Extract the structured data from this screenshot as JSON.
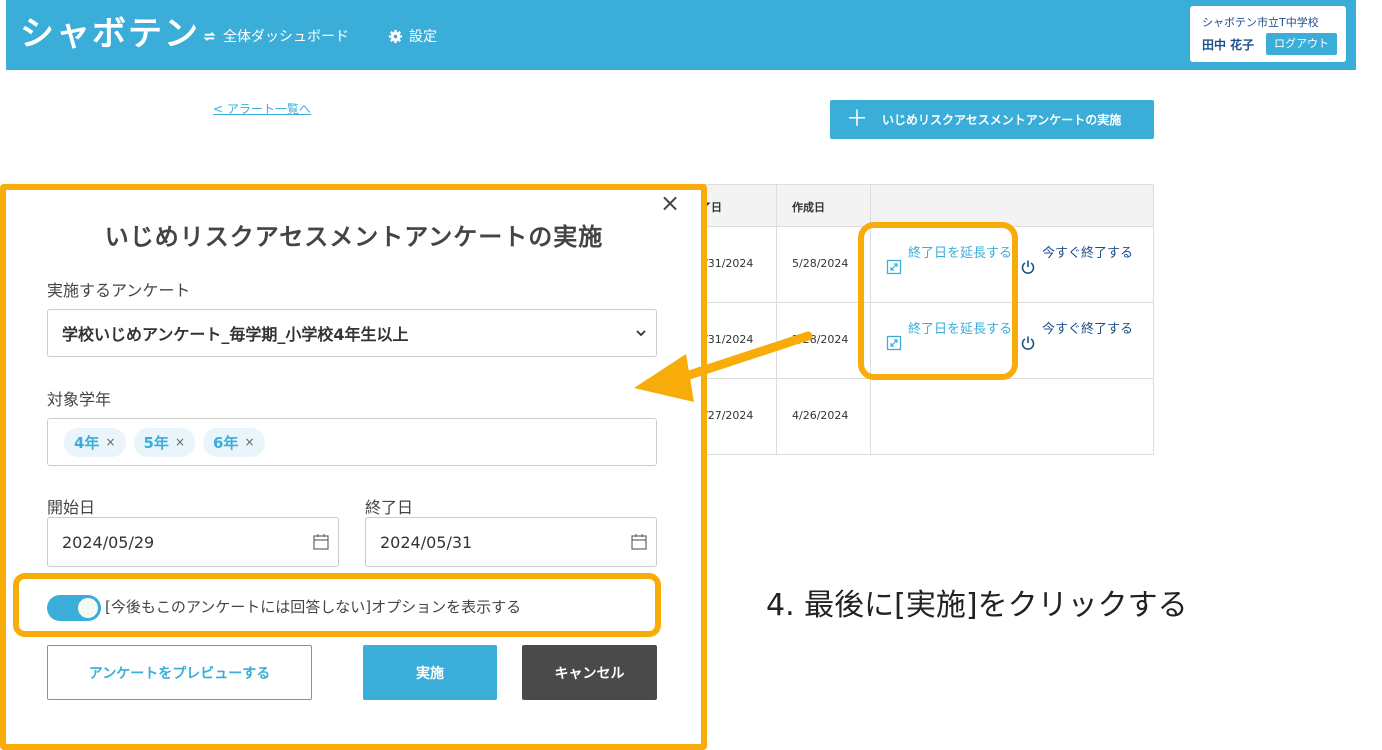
{
  "header": {
    "logo": "シャボテン",
    "nav": [
      {
        "label": "全体ダッシュボード",
        "icon": "refresh-icon"
      },
      {
        "label": "設定",
        "icon": "gear-icon"
      }
    ],
    "school": "シャボテン市立T中学校",
    "user_name": "田中 花子",
    "logout_label": "ログアウト"
  },
  "page": {
    "back_link": "< アラート一覧へ",
    "implement_button": "いじめリスクアセスメントアンケートの実施"
  },
  "table": {
    "headers": [
      "了日",
      "作成日"
    ],
    "rows": [
      {
        "end": "/31/2024",
        "created": "5/28/2024",
        "extend": "終了日を延長する",
        "end_now": "今すぐ終了する"
      },
      {
        "end": "/31/2024",
        "created": "5/28/2024",
        "extend": "終了日を延長する",
        "end_now": "今すぐ終了する"
      },
      {
        "end": "/27/2024",
        "created": "4/26/2024"
      }
    ]
  },
  "modal": {
    "title": "いじめリスクアセスメントアンケートの実施",
    "survey_label": "実施するアンケート",
    "survey_value": "学校いじめアンケート_毎学期_小学校4年生以上",
    "grade_label": "対象学年",
    "grades": [
      "4年",
      "5年",
      "6年"
    ],
    "tag_remove": "×",
    "start_label": "開始日",
    "start_value": "2024/05/29",
    "end_label": "終了日",
    "end_value": "2024/05/31",
    "toggle_label": "[今後もこのアンケートには回答しない]オプションを表示する",
    "toggle_on": true,
    "preview_button": "アンケートをプレビューする",
    "implement_button": "実施",
    "cancel_button": "キャンセル",
    "close": "×"
  },
  "annotation": {
    "text": "4. 最後に[実施]をクリックする",
    "color": "#f8ac0a"
  },
  "colors": {
    "brand": "#3aaed8",
    "dark_button": "#4a4a4a"
  }
}
